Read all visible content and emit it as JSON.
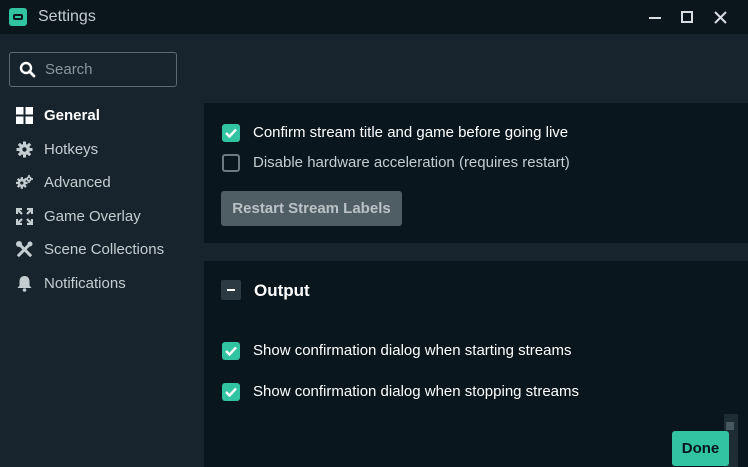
{
  "window": {
    "title": "Settings",
    "accent_color": "#31c3a2",
    "background_color": "#17242d",
    "titlebar_color": "#0b161c",
    "card_color": "#09161d"
  },
  "search": {
    "placeholder": "Search",
    "value": ""
  },
  "sidebar": {
    "items": [
      {
        "label": "General",
        "icon": "grid-icon",
        "active": true
      },
      {
        "label": "Hotkeys",
        "icon": "gear-icon",
        "active": false
      },
      {
        "label": "Advanced",
        "icon": "gears-icon",
        "active": false
      },
      {
        "label": "Game Overlay",
        "icon": "expand-icon",
        "active": false
      },
      {
        "label": "Scene Collections",
        "icon": "tools-icon",
        "active": false
      },
      {
        "label": "Notifications",
        "icon": "bell-icon",
        "active": false
      }
    ]
  },
  "general_section": {
    "options": [
      {
        "label": "Confirm stream title and game before going live",
        "checked": true
      },
      {
        "label": "Disable hardware acceleration (requires restart)",
        "checked": false
      }
    ],
    "restart_button_label": "Restart Stream Labels"
  },
  "output_section": {
    "title": "Output",
    "collapse_icon": "minus-icon",
    "options": [
      {
        "label": "Show confirmation dialog when starting streams",
        "checked": true
      },
      {
        "label": "Show confirmation dialog when stopping streams",
        "checked": true
      }
    ]
  },
  "footer": {
    "done_label": "Done"
  }
}
